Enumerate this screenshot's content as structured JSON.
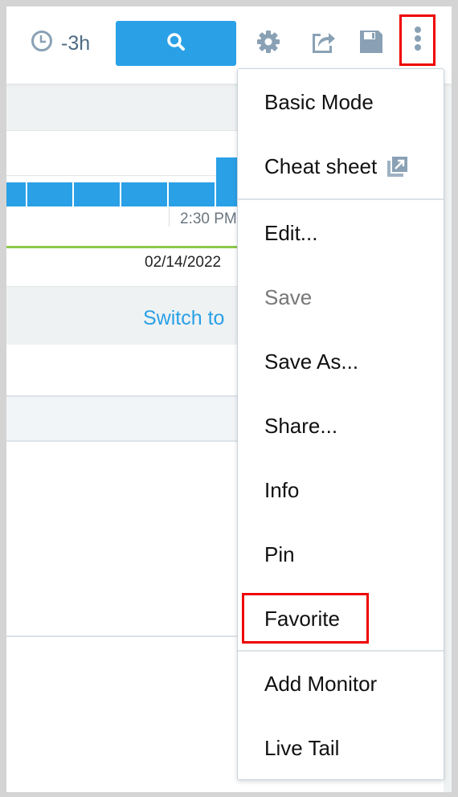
{
  "toolbar": {
    "time_range": "-3h",
    "icons": [
      "clock-icon",
      "search-icon",
      "gear-icon",
      "share-icon",
      "save-icon",
      "more-vertical-icon"
    ]
  },
  "chart": {
    "tick_label": "2:30 PM",
    "date_label": "02/14/2022",
    "bar_color": "#2aa0e6",
    "line_color": "#8cc84b"
  },
  "switch_link": "Switch to",
  "menu": {
    "items": [
      {
        "label": "Basic Mode"
      },
      {
        "label": "Cheat sheet",
        "icon": "external-link-icon"
      },
      {
        "label": "Edit..."
      },
      {
        "label": "Save",
        "disabled": true
      },
      {
        "label": "Save As..."
      },
      {
        "label": "Share..."
      },
      {
        "label": "Info"
      },
      {
        "label": "Pin"
      },
      {
        "label": "Favorite",
        "highlighted": true
      },
      {
        "label": "Add Monitor"
      },
      {
        "label": "Live Tail"
      }
    ]
  },
  "colors": {
    "accent": "#2aa0e6",
    "highlight": "#ee0000",
    "icon": "#8aa1b5"
  }
}
